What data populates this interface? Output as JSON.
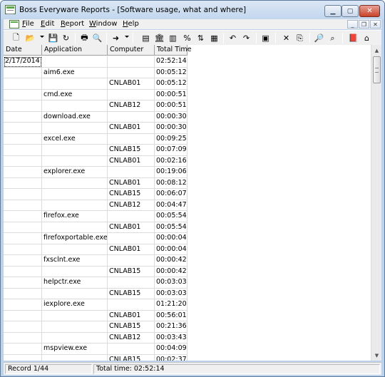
{
  "window": {
    "title": "Boss Everyware Reports - [Software usage, what and where]"
  },
  "window_controls": {
    "minimize": "▁",
    "maximize": "▢",
    "close": "✕"
  },
  "menu": {
    "items": [
      {
        "u": "F",
        "rest": "ile"
      },
      {
        "u": "E",
        "rest": "dit"
      },
      {
        "u": "R",
        "rest": "eport"
      },
      {
        "u": "W",
        "rest": "indow"
      },
      {
        "u": "H",
        "rest": "elp"
      }
    ],
    "mdi": {
      "minimize": "_",
      "restore": "❐",
      "close": "✕"
    }
  },
  "toolbar": {
    "icons": [
      "new-icon",
      "open-icon",
      "save-icon",
      "refresh-icon",
      "print-icon",
      "print-preview-icon",
      "export-icon",
      "report-icon",
      "building-icon",
      "columns-icon",
      "percent-icon",
      "sort-icon",
      "group-icon",
      "undo-icon",
      "redo-icon",
      "filter-icon",
      "delete-icon",
      "copy-icon",
      "find-icon",
      "find-next-icon",
      "book-icon",
      "home-icon"
    ],
    "glyphs": {
      "new": "🗋",
      "open": "📂",
      "save": "💾",
      "refresh": "↻",
      "print": "🖶",
      "preview": "🔍",
      "export": "➜",
      "report": "▤",
      "building": "🏛",
      "columns": "▥",
      "percent": "%",
      "sort": "⇅",
      "group": "▦",
      "undo": "↶",
      "redo": "↷",
      "filter": "▣",
      "delete": "✕",
      "copy": "⎘",
      "find": "🔎",
      "findnext": "⌕",
      "book": "📕",
      "home": "⌂"
    }
  },
  "table": {
    "columns": [
      "Date",
      "Application",
      "Computer",
      "Total Time"
    ],
    "rows": [
      [
        "2/17/2014",
        "",
        "",
        "02:52:14"
      ],
      [
        "",
        "aim6.exe",
        "",
        "00:05:12"
      ],
      [
        "",
        "",
        "CNLAB01",
        "00:05:12"
      ],
      [
        "",
        "cmd.exe",
        "",
        "00:00:51"
      ],
      [
        "",
        "",
        "CNLAB12",
        "00:00:51"
      ],
      [
        "",
        "download.exe",
        "",
        "00:00:30"
      ],
      [
        "",
        "",
        "CNLAB01",
        "00:00:30"
      ],
      [
        "",
        "excel.exe",
        "",
        "00:09:25"
      ],
      [
        "",
        "",
        "CNLAB15",
        "00:07:09"
      ],
      [
        "",
        "",
        "CNLAB01",
        "00:02:16"
      ],
      [
        "",
        "explorer.exe",
        "",
        "00:19:06"
      ],
      [
        "",
        "",
        "CNLAB01",
        "00:08:12"
      ],
      [
        "",
        "",
        "CNLAB15",
        "00:06:07"
      ],
      [
        "",
        "",
        "CNLAB12",
        "00:04:47"
      ],
      [
        "",
        "firefox.exe",
        "",
        "00:05:54"
      ],
      [
        "",
        "",
        "CNLAB01",
        "00:05:54"
      ],
      [
        "",
        "firefoxportable.exe",
        "",
        "00:00:04"
      ],
      [
        "",
        "",
        "CNLAB01",
        "00:00:04"
      ],
      [
        "",
        "fxsclnt.exe",
        "",
        "00:00:42"
      ],
      [
        "",
        "",
        "CNLAB15",
        "00:00:42"
      ],
      [
        "",
        "helpctr.exe",
        "",
        "00:03:03"
      ],
      [
        "",
        "",
        "CNLAB15",
        "00:03:03"
      ],
      [
        "",
        "iexplore.exe",
        "",
        "01:21:20"
      ],
      [
        "",
        "",
        "CNLAB01",
        "00:56:01"
      ],
      [
        "",
        "",
        "CNLAB15",
        "00:21:36"
      ],
      [
        "",
        "",
        "CNLAB12",
        "00:03:43"
      ],
      [
        "",
        "mspview.exe",
        "",
        "00:04:09"
      ],
      [
        "",
        "",
        "CNLAB15",
        "00:02:37"
      ]
    ]
  },
  "scrollbar": {
    "up": "▲",
    "down": "▼"
  },
  "status": {
    "record": "Record 1/44",
    "total_time": "Total time: 02:52:14"
  }
}
